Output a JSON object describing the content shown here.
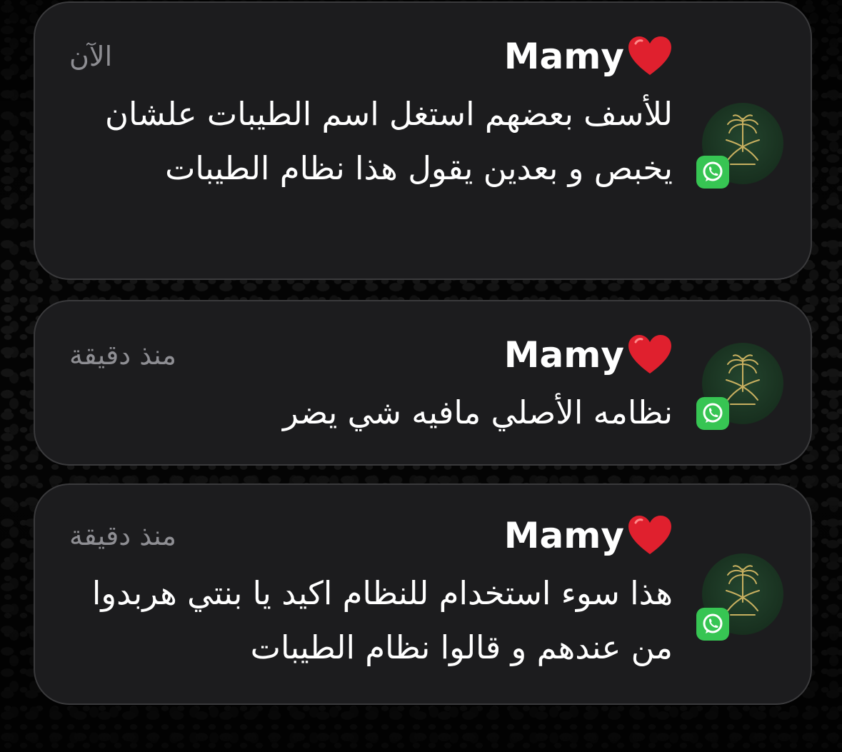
{
  "notifications": [
    {
      "sender": "Mamy",
      "time": "الآن",
      "message": "للأسف بعضهم استغل اسم الطيبات علشان يخبص و بعدين يقول هذا نظام الطيبات",
      "app_icon": "whatsapp-icon",
      "sender_icon": "heart-icon"
    },
    {
      "sender": "Mamy",
      "time": "منذ دقيقة",
      "message": "نظامه الأصلي مافيه شي يضر",
      "app_icon": "whatsapp-icon",
      "sender_icon": "heart-icon"
    },
    {
      "sender": "Mamy",
      "time": "منذ دقيقة",
      "message": "هذا سوء استخدام للنظام اكيد يا بنتي هربدوا من عندهم و قالوا نظام الطيبات",
      "app_icon": "whatsapp-icon",
      "sender_icon": "heart-icon"
    }
  ],
  "colors": {
    "card_background": "#1c1c1e",
    "card_border": "#3a3a3c",
    "text_primary": "#ffffff",
    "text_secondary": "#8e8e93",
    "whatsapp_green": "#37c553",
    "heart_red": "#e0202e",
    "avatar_green": "#1f3d28"
  }
}
